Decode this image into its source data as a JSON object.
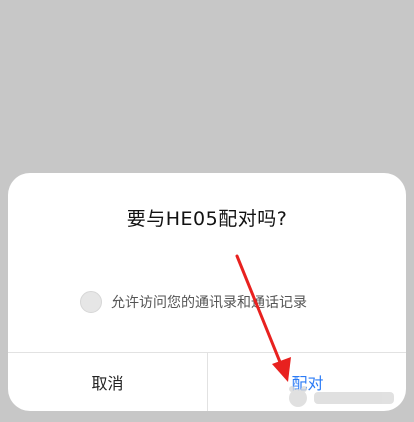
{
  "dialog": {
    "title": "要与HE05配对吗?",
    "permission_label": "允许访问您的通讯录和通话记录",
    "permission_checked": false,
    "cancel_label": "取消",
    "pair_label": "配对"
  },
  "colors": {
    "backdrop": "#c7c7c7",
    "dialog_bg": "#ffffff",
    "accent": "#2b7bf6",
    "annotation_arrow": "#e8211f"
  }
}
